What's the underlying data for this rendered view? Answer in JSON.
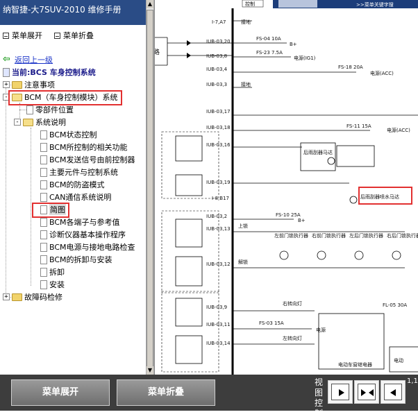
{
  "app_title": "纳智捷-大7SUV-2010 维修手册",
  "menu": {
    "expand": "菜单展开",
    "collapse": "菜单折叠"
  },
  "tree": {
    "back": "返回上一级",
    "current": "当前:BCS 车身控制系统",
    "notes": "注意事项",
    "bcm": "BCM（车身控制模块）系统",
    "parts": "零部件位置",
    "system_desc": "系统说明",
    "items": [
      "BCM状态控制",
      "BCM所控制的相关功能",
      "BCM发送信号由前控制器",
      "主要元件与控制系统",
      "BCM的防盗模式",
      "CAN通信系统说明",
      "简图",
      "BCM各端子与参考值",
      "诊断仪器基本操作程序",
      "BCM电源与接地电路检查",
      "BCM的拆卸与安装",
      "拆卸",
      "安装"
    ],
    "dtc": "故障码检修"
  },
  "diagram": {
    "top_right": ">>菜单关键字搜",
    "top_mid": "控制",
    "connectors": [
      "I-7,A7",
      "IUB-03,20",
      "IUB-03,8",
      "IUB-03,4",
      "IUB-03,3",
      "IUB-03,17",
      "IUB-03,18",
      "IUB-03,16",
      "IUB-03,19",
      "I-8,B17",
      "IUB-03,2",
      "IUB-03,13",
      "IUB-03,12",
      "IUB-03,9",
      "IUB-03,11",
      "IUB-03,14"
    ],
    "labels": {
      "ground": "接地",
      "fs04": "FS-04  10A",
      "fs23": "FS-23  7.5A",
      "fs18": "FS-18  20A",
      "fs11": "FS-11  15A",
      "fs10": "FS-10  25A",
      "fs03": "FS-03  15A",
      "fl05": "FL-05  30A",
      "bplus": "B+",
      "ig1": "电源(IG1)",
      "acc": "电源(ACC)",
      "power": "电源",
      "wiper_motor": "后雨刮器马达",
      "washer_motor": "后雨刮器喷水马达",
      "lock": "上锁",
      "unlock": "解锁",
      "actuators": [
        "左前门锁执行器",
        "右前门锁执行器",
        "左后门锁执行器",
        "右后门锁执行器"
      ],
      "right_turn": "右转向灯",
      "left_turn": "左转向灯",
      "window_motor": "电动车窗继电器",
      "window2": "电动",
      "lu": "路",
      "ground2": "接地"
    }
  },
  "bottom": {
    "expand": "菜单展开",
    "collapse": "菜单折叠",
    "view_label": "视图控制",
    "page": "1,1"
  },
  "colors": {
    "title_bar": "#2a4c86",
    "link": "#1a33c8",
    "highlight": "#e23030",
    "bottom_bar": "#3d3d3d"
  }
}
